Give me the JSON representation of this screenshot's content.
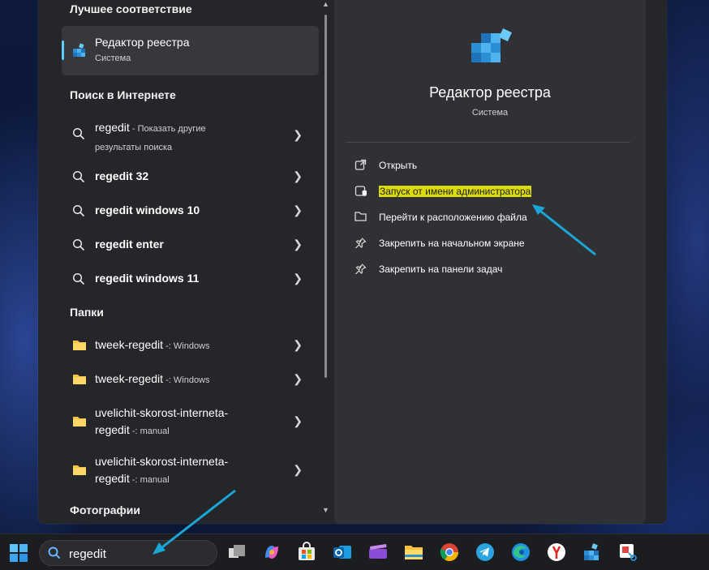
{
  "search_panel": {
    "best_match": {
      "heading": "Лучшее соответствие",
      "title": "Редактор реестра",
      "subtitle": "Система"
    },
    "web": {
      "heading": "Поиск в Интернете",
      "items": [
        {
          "query": "regedit",
          "suffix": " - Показать другие",
          "suffix2": "результаты поиска"
        },
        {
          "query": "regedit 32"
        },
        {
          "query": "regedit windows 10"
        },
        {
          "query": "regedit enter"
        },
        {
          "query": "regedit windows 11"
        }
      ]
    },
    "folders": {
      "heading": "Папки",
      "items": [
        {
          "name": "tweek-regedit",
          "location": " -: Windows"
        },
        {
          "name": "tweek-regedit",
          "location": " -: Windows"
        },
        {
          "name_line1": "uvelichit-skorost-interneta-",
          "name_line2": "regedit",
          "location": " -: manual"
        },
        {
          "name_line1": "uvelichit-skorost-interneta-",
          "name_line2": "regedit",
          "location": " -: manual"
        }
      ]
    },
    "photos_heading": "Фотографии"
  },
  "preview": {
    "title": "Редактор реестра",
    "subtitle": "Система",
    "actions": [
      {
        "label": "Открыть",
        "icon": "open-external-icon"
      },
      {
        "label": "Запуск от имени администратора",
        "icon": "shield-admin-icon"
      },
      {
        "label": "Перейти к расположению файла",
        "icon": "folder-icon"
      },
      {
        "label": "Закрепить на начальном экране",
        "icon": "pin-icon"
      },
      {
        "label": "Закрепить на панели задач",
        "icon": "pin-icon"
      }
    ]
  },
  "taskbar": {
    "search_value": "regedit",
    "apps": [
      "task-view",
      "copilot",
      "microsoft-store",
      "outlook",
      "clipchamp",
      "file-explorer",
      "chrome",
      "telegram",
      "edge",
      "yandex-browser",
      "registry-editor",
      "snipping-tool"
    ]
  },
  "colors": {
    "accent": "#60cdff",
    "highlight": "#f0f000",
    "annotation_arrow": "#1aa6d6"
  }
}
